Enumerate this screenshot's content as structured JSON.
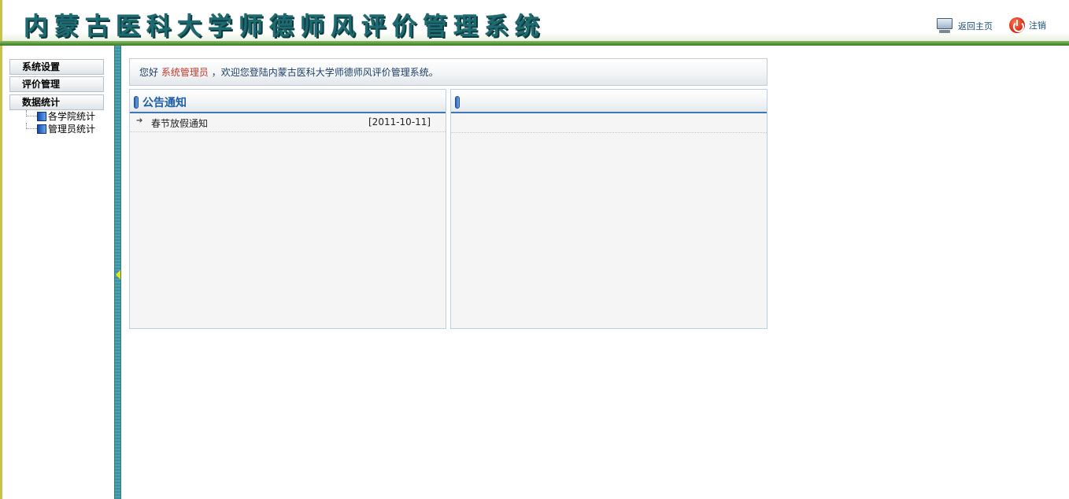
{
  "header": {
    "title": "内蒙古医科大学师德师风评价管理系统",
    "home_label": "返回主页",
    "logout_label": "注销",
    "icons": {
      "home": "monitor-icon",
      "logout": "power-icon"
    }
  },
  "sidebar": {
    "menus": [
      {
        "label": "系统设置"
      },
      {
        "label": "评价管理"
      },
      {
        "label": "数据统计"
      }
    ],
    "tree_items": [
      {
        "label": "各学院统计"
      },
      {
        "label": "管理员统计"
      }
    ]
  },
  "welcome": {
    "prefix": "您好",
    "user": "系统管理员",
    "suffix": "，欢迎您登陆内蒙古医科大学师德师风评价管理系统。"
  },
  "notice_panel": {
    "title": "公告通知",
    "items": [
      {
        "title": "春节放假通知",
        "date": "[2011-10-11]"
      }
    ]
  },
  "right_panel": {
    "title": ""
  },
  "colors": {
    "title_teal": "#1d6a70",
    "header_green": "#5e9a3e",
    "splitter_teal": "#4aa4b4",
    "panel_blue": "#3a78b8",
    "user_red": "#c0392b"
  }
}
